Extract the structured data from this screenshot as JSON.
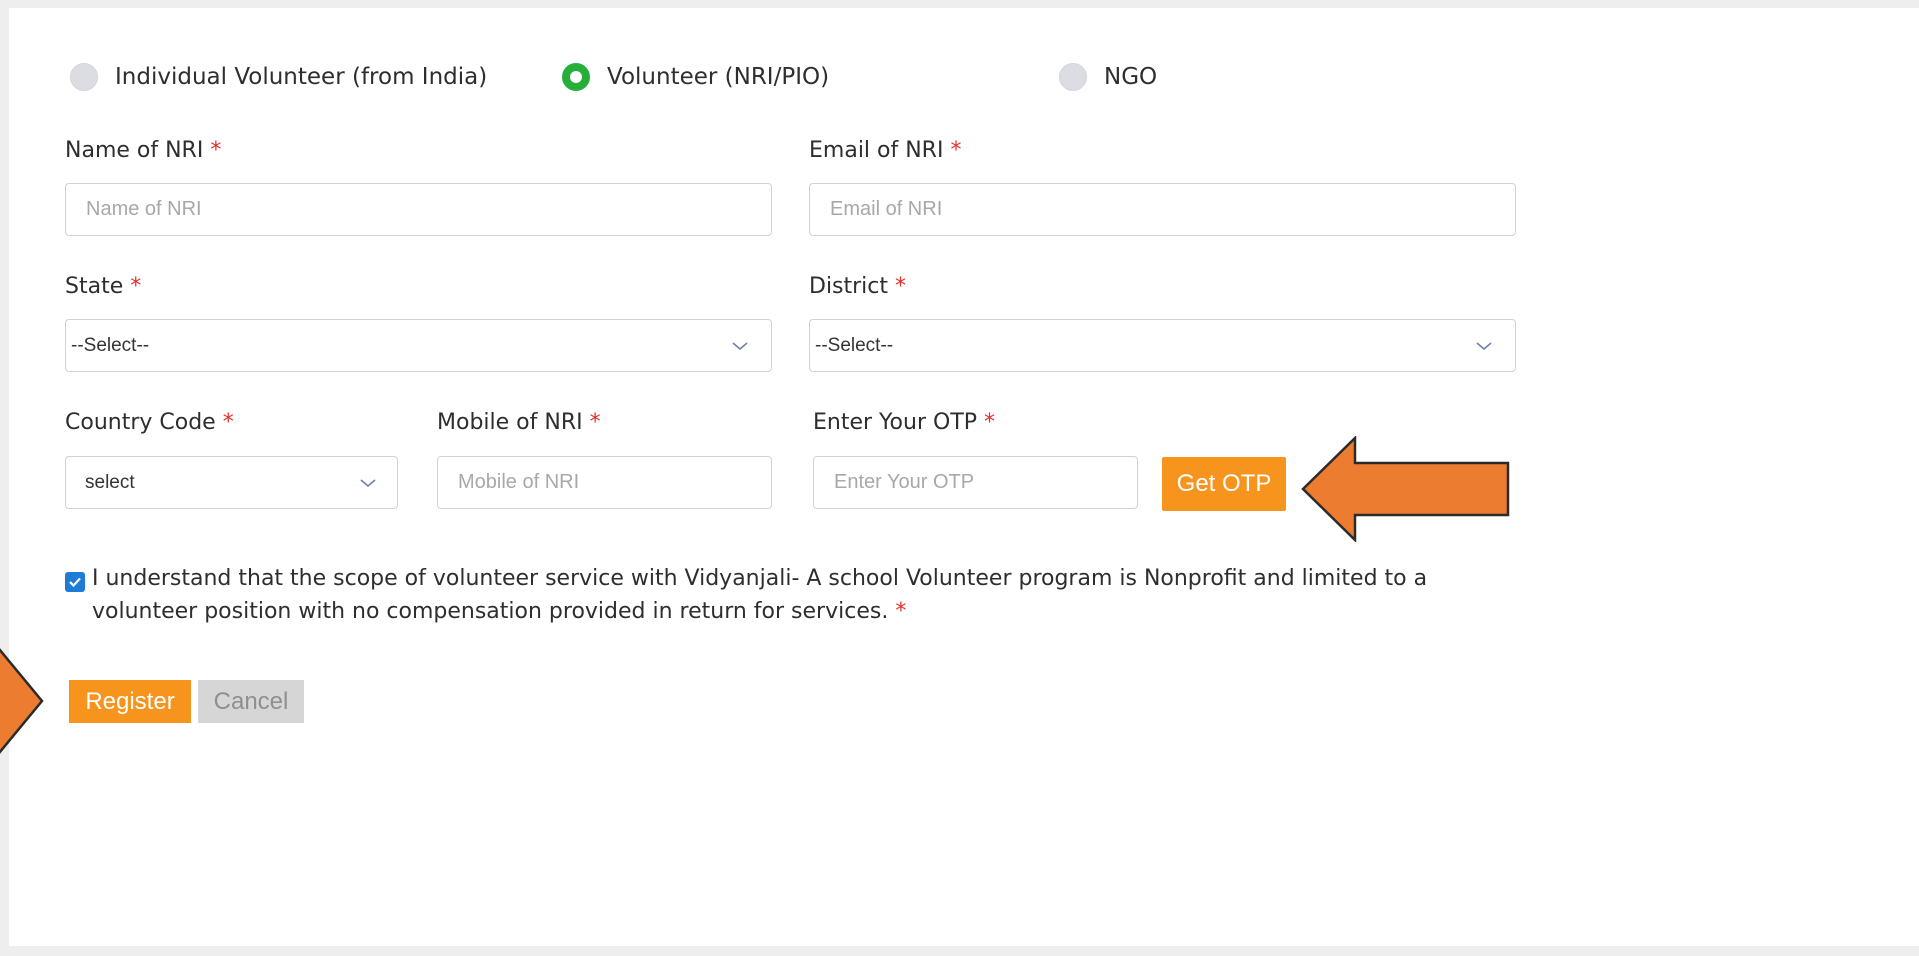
{
  "volunteer_type": {
    "options": [
      {
        "label": "Individual Volunteer (from India)",
        "selected": false
      },
      {
        "label": "Volunteer (NRI/PIO)",
        "selected": true
      },
      {
        "label": "NGO",
        "selected": false
      }
    ]
  },
  "form": {
    "required_mark": "*",
    "name": {
      "label": "Name of NRI",
      "placeholder": "Name of NRI",
      "value": ""
    },
    "email": {
      "label": "Email of NRI",
      "placeholder": "Email of NRI",
      "value": ""
    },
    "state": {
      "label": "State",
      "selected": "--Select--"
    },
    "district": {
      "label": "District",
      "selected": "--Select--"
    },
    "country_code": {
      "label": "Country Code",
      "selected": "select"
    },
    "mobile": {
      "label": "Mobile of NRI",
      "placeholder": "Mobile of NRI",
      "value": ""
    },
    "otp": {
      "label": "Enter Your OTP",
      "placeholder": "Enter Your OTP",
      "value": ""
    },
    "get_otp_label": "Get OTP",
    "consent": {
      "checked": true,
      "text": "I understand that the scope of volunteer service with Vidyanjali- A school Volunteer program is Nonprofit and limited to a volunteer position with no compensation provided in return for services."
    },
    "register_label": "Register",
    "cancel_label": "Cancel"
  },
  "annotations": {
    "arrow_color": "#ec7d30"
  },
  "colors": {
    "accent_orange": "#f7941d",
    "radio_selected": "#27ae3a",
    "required": "#e0312b",
    "checkbox": "#1e7cd6"
  }
}
